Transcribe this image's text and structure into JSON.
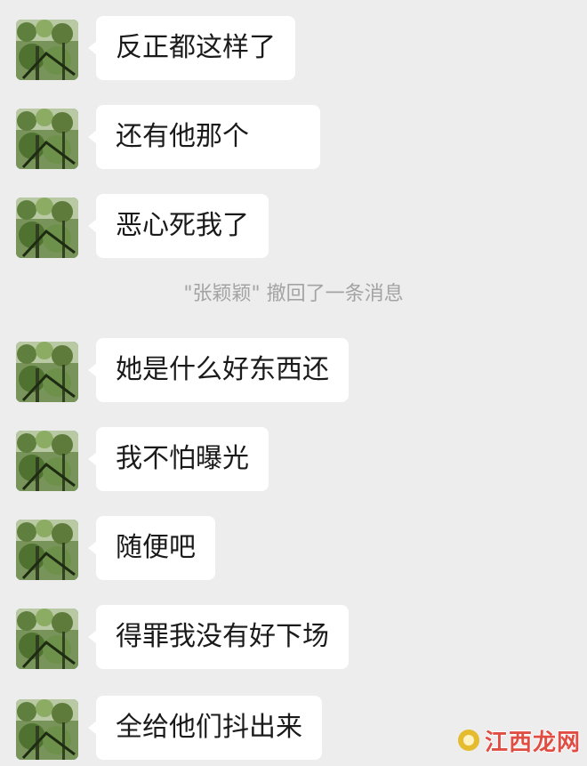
{
  "colors": {
    "chat_background": "#ededed",
    "bubble_background": "#ffffff",
    "message_text": "#1a1a1a",
    "system_text": "#a3a3a3",
    "watermark_text": "#e04d43"
  },
  "contact": {
    "avatar_icon": "green-foliage-avatar"
  },
  "messages": [
    {
      "text": "反正都这样了"
    },
    {
      "text": "还有他那个"
    },
    {
      "text": "恶心死我了"
    },
    {
      "text": "她是什么好东西还"
    },
    {
      "text": "我不怕曝光"
    },
    {
      "text": "随便吧"
    },
    {
      "text": "得罪我没有好下场"
    },
    {
      "text": "全给他们抖出来"
    }
  ],
  "system_notice": {
    "text": "\"张颖颖\" 撤回了一条消息"
  },
  "watermark": {
    "text": "江西龙网"
  }
}
